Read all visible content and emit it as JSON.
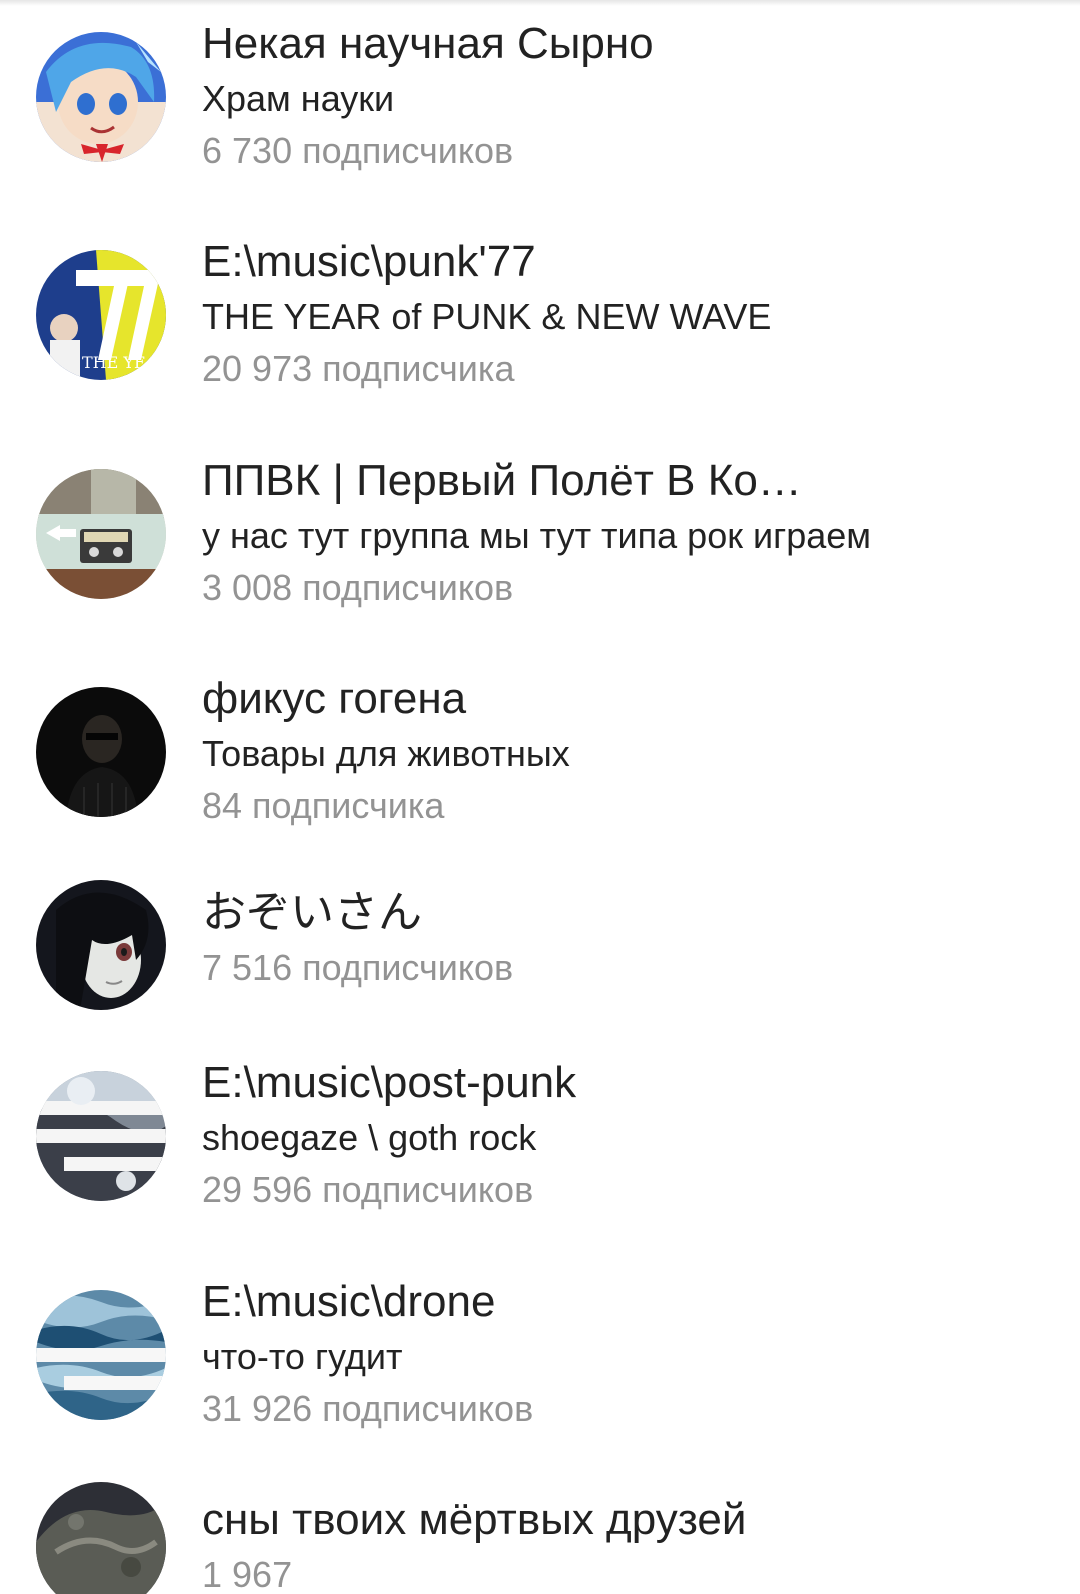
{
  "groups": [
    {
      "title": "Некая научная Сырно",
      "subtitle": "Храм науки",
      "members": "6 730 подписчиков",
      "avatar_icon": "anime-girl-avatar-icon"
    },
    {
      "title": "E:\\music\\punk'77",
      "subtitle": "THE YEAR of PUNK & NEW WAVE",
      "members": "20 973 подписчика",
      "avatar_icon": "punk77-avatar-icon",
      "avatar_text": "THE YEA"
    },
    {
      "title": "ППВК | Первый Полёт В Ко…",
      "subtitle": "у нас тут группа мы тут типа рок играем",
      "members": "3 008 подписчиков",
      "avatar_icon": "cassette-avatar-icon"
    },
    {
      "title": "фикус гогена",
      "subtitle": "Товары для животных",
      "members": "84 подписчика",
      "avatar_icon": "dark-portrait-avatar-icon"
    },
    {
      "title": "おぞいさん",
      "subtitle": "",
      "members": "7 516 подписчиков",
      "avatar_icon": "anime-dark-hair-avatar-icon"
    },
    {
      "title": "E:\\music\\post-punk",
      "subtitle": "shoegaze \\ goth rock",
      "members": "29 596 подписчиков",
      "avatar_icon": "postpunk-avatar-icon"
    },
    {
      "title": "E:\\music\\drone",
      "subtitle": "что-то гудит",
      "members": "31 926 подписчиков",
      "avatar_icon": "drone-waves-avatar-icon"
    },
    {
      "title": "сны твоих мёртвых друзей",
      "subtitle": "",
      "members": "1 967",
      "avatar_icon": "rock-texture-avatar-icon"
    }
  ],
  "colors": {
    "title": "#222222",
    "subtitle": "#222222",
    "members": "#939393",
    "background": "#ffffff"
  }
}
